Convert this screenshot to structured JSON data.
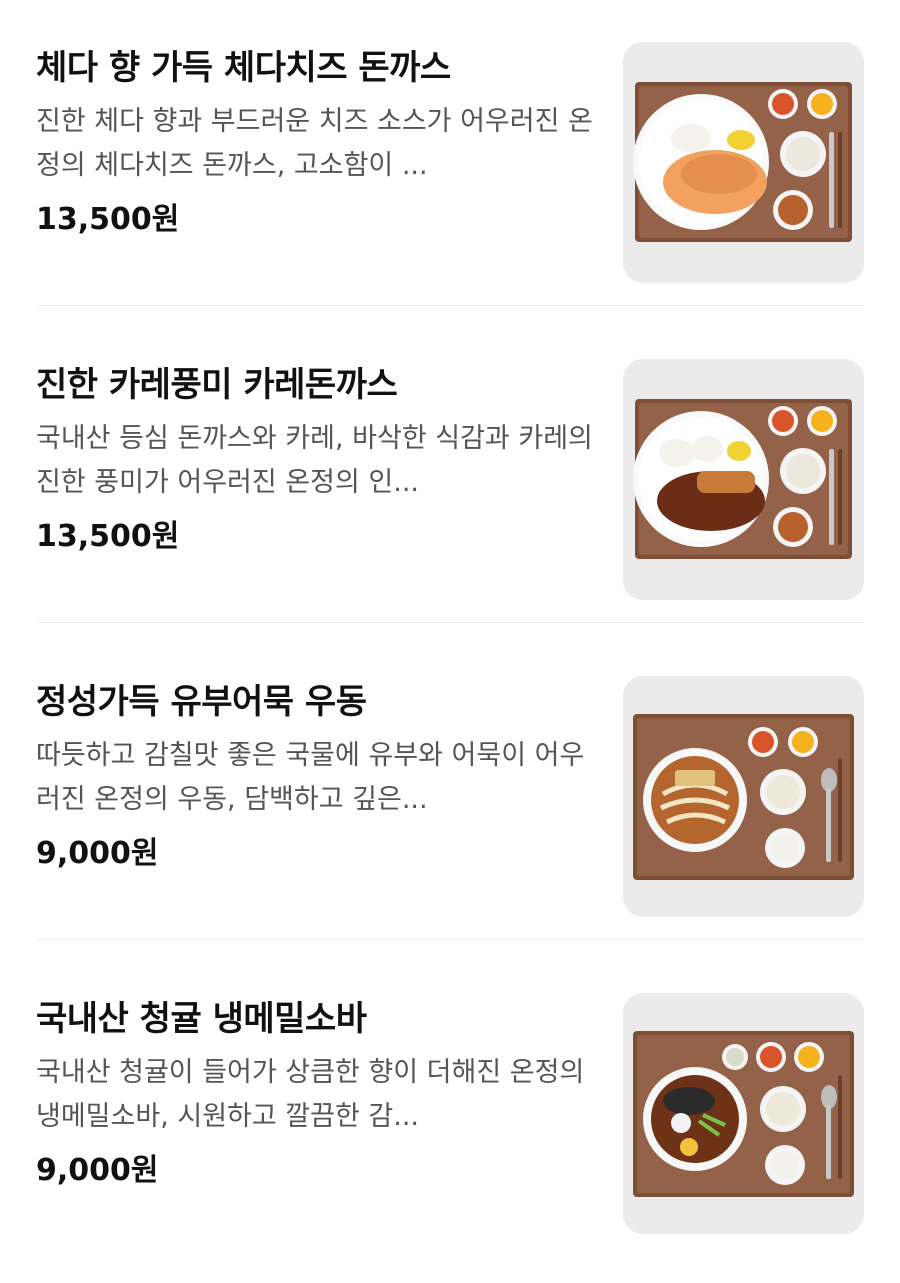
{
  "menu_items": [
    {
      "name": "체다 향 가득 체다치즈 돈까스",
      "description": "진한 체다 향과 부드러운 치즈 소스가 어우러진 온정의 체다치즈 돈까스, 고소함이 ...",
      "price": "13,500원",
      "photo": "cheddar-cheese-tonkatsu-photo"
    },
    {
      "name": "진한 카레풍미 카레돈까스",
      "description": "국내산 등심 돈까스와 카레, 바삭한 식감과 카레의 진한 풍미가 어우러진 온정의 인...",
      "price": "13,500원",
      "photo": "curry-tonkatsu-photo"
    },
    {
      "name": "정성가득 유부어묵 우동",
      "description": "따듯하고 감칠맛 좋은 국물에 유부와 어묵이 어우러진 온정의 우동, 담백하고 깊은...",
      "price": "9,000원",
      "photo": "fishcake-udon-photo"
    },
    {
      "name": "국내산 청귤 냉메밀소바",
      "description": "국내산 청귤이 들어가 상큼한 향이 더해진 온정의 냉메밀소바, 시원하고 깔끔한 감...",
      "price": "9,000원",
      "photo": "cold-soba-photo"
    }
  ],
  "colors": {
    "tray": "#8a5a3e",
    "background": "#ffffff",
    "divider": "#ececec"
  }
}
